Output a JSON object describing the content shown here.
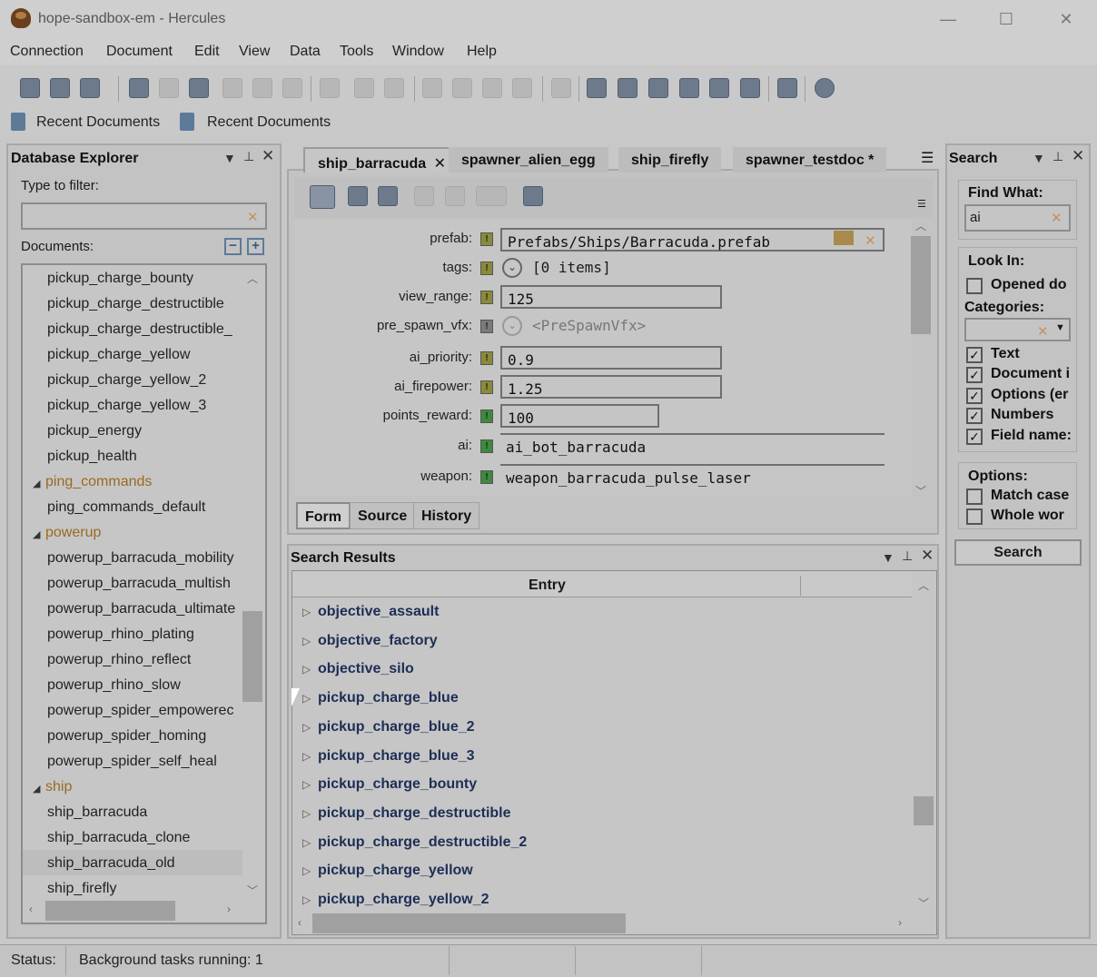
{
  "window": {
    "title": "hope-sandbox-em - Hercules",
    "controls": {
      "minimize": "—",
      "maximize": "☐",
      "close": "✕"
    }
  },
  "menu": [
    "Connection",
    "Document",
    "Edit",
    "View",
    "Data",
    "Tools",
    "Window",
    "Help"
  ],
  "recent": {
    "left_label": "Recent Documents",
    "right_label": "Recent Documents"
  },
  "explorer": {
    "title": "Database Explorer",
    "filter_label": "Type to filter:",
    "filter_value": "",
    "documents_label": "Documents:",
    "items": [
      "pickup_charge_bounty",
      "pickup_charge_destructible",
      "pickup_charge_destructible_",
      "pickup_charge_yellow",
      "pickup_charge_yellow_2",
      "pickup_charge_yellow_3",
      "pickup_energy",
      "pickup_health",
      "ping_commands",
      "ping_commands_default",
      "powerup",
      "powerup_barracuda_mobility",
      "powerup_barracuda_multish",
      "powerup_barracuda_ultimate",
      "powerup_rhino_plating",
      "powerup_rhino_reflect",
      "powerup_rhino_slow",
      "powerup_spider_empowerec",
      "powerup_spider_homing",
      "powerup_spider_self_heal",
      "ship",
      "ship_barracuda",
      "ship_barracuda_clone",
      "ship_barracuda_old",
      "ship_firefly"
    ]
  },
  "tabs": {
    "items": [
      "ship_barracuda",
      "spawner_alien_egg",
      "ship_firefly",
      "spawner_testdoc *"
    ],
    "close_glyph": "✕"
  },
  "form": {
    "fields": [
      {
        "label": "prefab:",
        "value": "Prefabs/Ships/Barracuda.prefab"
      },
      {
        "label": "tags:",
        "value": "[0 items]"
      },
      {
        "label": "view_range:",
        "value": "125"
      },
      {
        "label": "pre_spawn_vfx:",
        "value": "<PreSpawnVfx>"
      },
      {
        "label": "ai_priority:",
        "value": "0.9"
      },
      {
        "label": "ai_firepower:",
        "value": "1.25"
      },
      {
        "label": "points_reward:",
        "value": "100"
      },
      {
        "label": "ai:",
        "value": "ai_bot_barracuda"
      },
      {
        "label": "weapon:",
        "value": "weapon_barracuda_pulse_laser"
      }
    ],
    "bottom_tabs": [
      "Form",
      "Source",
      "History"
    ]
  },
  "results": {
    "title": "Search Results",
    "column": "Entry",
    "rows": [
      "objective_assault",
      "objective_factory",
      "objective_silo",
      "pickup_charge_blue",
      "pickup_charge_blue_2",
      "pickup_charge_blue_3",
      "pickup_charge_bounty",
      "pickup_charge_destructible",
      "pickup_charge_destructible_2",
      "pickup_charge_yellow",
      "pickup_charge_yellow_2"
    ]
  },
  "search": {
    "title": "Search",
    "find_label": "Find What:",
    "find_value": "ai",
    "look_in_label": "Look In:",
    "opened_docs": "Opened do",
    "categories_label": "Categories:",
    "categories": [
      {
        "label": "Text",
        "checked": true
      },
      {
        "label": "Document i",
        "checked": true
      },
      {
        "label": "Options (er",
        "checked": true
      },
      {
        "label": "Numbers",
        "checked": true
      },
      {
        "label": "Field name:",
        "checked": true
      }
    ],
    "options_label": "Options:",
    "match_case": "Match case",
    "whole_word": "Whole wor",
    "button": "Search",
    "check_glyph": "✓"
  },
  "status": {
    "label": "Status:",
    "text": "Background tasks running: 1"
  },
  "colors": {
    "folder": "#9a6a22",
    "result_text": "#1d2e55",
    "badge_yellow": "#8a8a3a",
    "badge_green": "#3d8a3d"
  }
}
